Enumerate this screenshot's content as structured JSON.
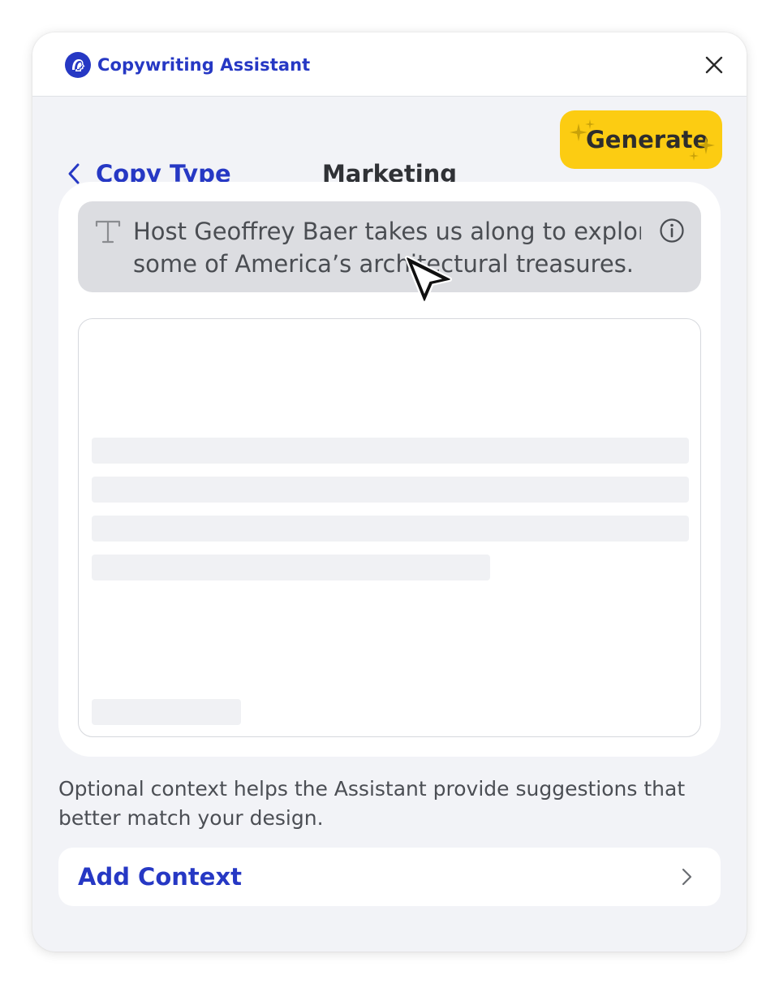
{
  "header": {
    "app_title": "Copywriting Assistant",
    "logo_icon": "pbs-head-logo-icon",
    "close_icon": "close-x-icon"
  },
  "nav": {
    "back_label": "Copy Type",
    "back_icon": "chevron-left-icon",
    "section_title": "Marketing",
    "generate_label": "Generate",
    "generate_icon": "sparkle-icon"
  },
  "input": {
    "line1": "Host Geoffrey Baer takes us along to explore",
    "line2": "some of America’s architectural treasures.",
    "text_icon": "text-type-icon",
    "info_icon": "info-icon"
  },
  "helper_text": "Optional context helps the Assistant provide suggestions that better match your design.",
  "add_context": {
    "label": "Add Context",
    "icon": "chevron-right-icon"
  },
  "colors": {
    "accent": "#2638c4",
    "generate_bg": "#fccc12",
    "panel_bg": "#f2f3f7",
    "input_bg": "#dcdde1"
  }
}
